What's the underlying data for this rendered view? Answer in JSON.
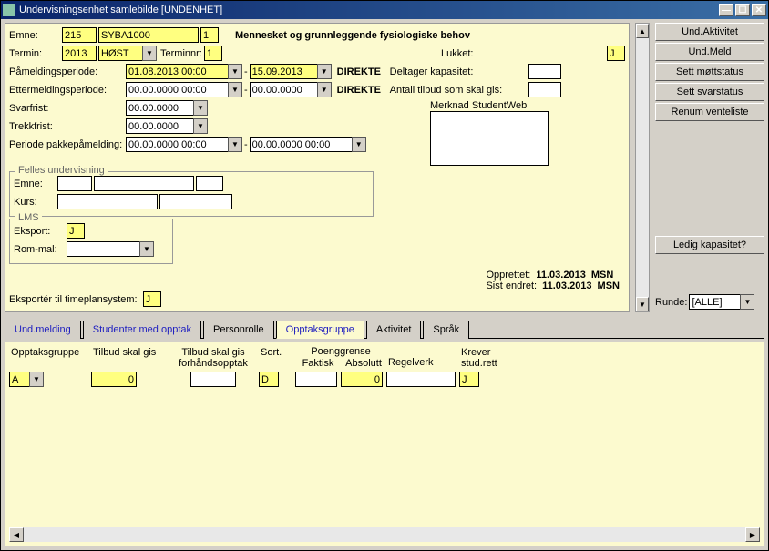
{
  "title": "Undervisningsenhet samlebilde [UNDENHET]",
  "emne": {
    "label": "Emne:",
    "code": "215",
    "subject": "SYBA1000",
    "num": "1",
    "title": "Mennesket og grunnleggende fysiologiske behov"
  },
  "termin": {
    "label": "Termin:",
    "year": "2013",
    "season": "HØST",
    "terminnr_label": "Terminnr:",
    "terminnr": "1"
  },
  "lukket": {
    "label": "Lukket:",
    "value": "J"
  },
  "pameld": {
    "label": "Påmeldingsperiode:",
    "from": "01.08.2013 00:00",
    "to": "15.09.2013",
    "mode": "DIREKTE"
  },
  "deltager": {
    "label": "Deltager kapasitet:",
    "value": ""
  },
  "etter": {
    "label": "Ettermeldingsperiode:",
    "from": "00.00.0000 00:00",
    "to": "00.00.0000",
    "mode": "DIREKTE"
  },
  "antall": {
    "label": "Antall tilbud som skal gis:",
    "value": ""
  },
  "svarfrist": {
    "label": "Svarfrist:",
    "value": "00.00.0000"
  },
  "merknad": {
    "label": "Merknad StudentWeb"
  },
  "trekkfrist": {
    "label": "Trekkfrist:",
    "value": "00.00.0000"
  },
  "pakke": {
    "label": "Periode pakkepåmelding:",
    "from": "00.00.0000 00:00",
    "to": "00.00.0000 00:00"
  },
  "felles": {
    "legend": "Felles undervisning",
    "emne_label": "Emne:",
    "kurs_label": "Kurs:"
  },
  "lms": {
    "legend": "LMS",
    "eksport_label": "Eksport:",
    "eksport": "J",
    "rommal_label": "Rom-mal:"
  },
  "eksporter": {
    "label": "Eksportér til timeplansystem:",
    "value": "J"
  },
  "opprettet": {
    "label": "Opprettet:",
    "date": "11.03.2013",
    "user": "MSN"
  },
  "sistendret": {
    "label": "Sist endret:",
    "date": "11.03.2013",
    "user": "MSN"
  },
  "buttons": {
    "undaktivitet": "Und.Aktivitet",
    "undmeld": "Und.Meld",
    "mottstatus": "Sett møttstatus",
    "svarstatus": "Sett svarstatus",
    "renum": "Renum venteliste",
    "ledig": "Ledig kapasitet?"
  },
  "runde": {
    "label": "Runde:",
    "value": "[ALLE]"
  },
  "tabs": {
    "undmelding": "Und.melding",
    "studenter": "Studenter med opptak",
    "personrolle": "Personrolle",
    "opptaksgruppe": "Opptaksgruppe",
    "aktivitet": "Aktivitet",
    "sprak": "Språk"
  },
  "grid": {
    "headers": {
      "opptaksgruppe": "Opptaksgruppe",
      "tilbudskalgis": "Tilbud skal gis",
      "forhandsopptak": "Tilbud skal gis forhåndsopptak",
      "sort": "Sort.",
      "poenggrense": "Poenggrense",
      "faktisk": "Faktisk",
      "absolutt": "Absolutt",
      "regelverk": "Regelverk",
      "kreverstudrett": "Krever stud.rett"
    },
    "row": {
      "gruppe": "A",
      "tilbud": "0",
      "forhand": "",
      "sort": "D",
      "faktisk": "",
      "absolutt": "0",
      "regelverk": "",
      "krever": "J"
    }
  }
}
